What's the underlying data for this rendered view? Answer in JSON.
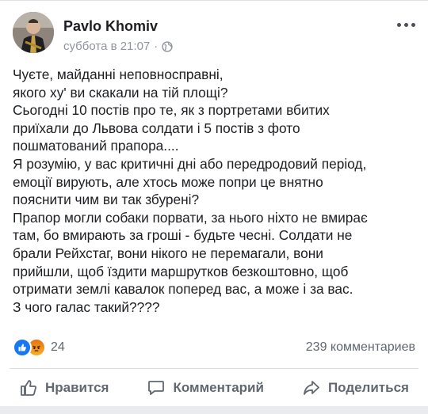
{
  "post": {
    "author": "Pavlo Khomiv",
    "timestamp": "суббота в 21:07",
    "separator": "·",
    "privacy_icon": "globe-icon",
    "lines": [
      "Чуєте, майданні неповносправні,",
      "якого ху' ви скакали на тій площі?",
      "Сьогодні 10 постів про те, як з портретами вбитих",
      "приїхали до Львова солдати і 5 постів з фото",
      "пошматований прапора....",
      "Я розумію, у вас критичні дні або передродовий період,",
      "емоції вирують, але хтось може попри це внятно",
      "пояснити чим ви так збурені?",
      "Прапор могли собаки порвати, за нього ніхто не вмирає",
      "там, бо вмирають за гроші - будьте чесні. Солдати не",
      "брали Рейхстаг, вони нікого не перемагали, вони",
      "прийшли, щоб їздити маршрутков безкоштовно, щоб",
      "отримати землі кавалок поперед вас, а може і за вас.",
      "З чого галас такий????"
    ]
  },
  "reactions": {
    "icons": [
      "like-icon",
      "angry-icon"
    ],
    "count": "24",
    "comments": "239 комментариев"
  },
  "actions": {
    "like": "Нравится",
    "comment": "Комментарий",
    "share": "Поделиться"
  },
  "colors": {
    "text": "#1c1e21",
    "secondary": "#606770",
    "like_blue": "#1877f2"
  }
}
